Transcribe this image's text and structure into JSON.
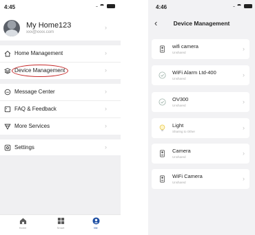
{
  "left_screen": {
    "status": {
      "time": "4:45",
      "signal": "....."
    },
    "profile": {
      "name": "My Home123",
      "email": "xxx@xxxx.com"
    },
    "menu_group_1": [
      {
        "label": "Home Management",
        "icon": "home-icon"
      },
      {
        "label": "Device Management",
        "icon": "layers-icon",
        "highlighted": true
      }
    ],
    "menu_group_2": [
      {
        "label": "Message Center",
        "icon": "message-icon"
      },
      {
        "label": "FAQ & Feedback",
        "icon": "faq-icon"
      },
      {
        "label": "More Services",
        "icon": "services-icon"
      }
    ],
    "menu_group_3": [
      {
        "label": "Settings",
        "icon": "settings-icon"
      }
    ],
    "tabs": [
      {
        "label": "Home",
        "icon": "home-tab-icon",
        "active": false
      },
      {
        "label": "Smart",
        "icon": "smart-tab-icon",
        "active": false
      },
      {
        "label": "Me",
        "icon": "me-tab-icon",
        "active": true
      }
    ],
    "highlight_color": "#c62828",
    "active_tab_color": "#1e4fa3"
  },
  "right_screen": {
    "status": {
      "time": "4:46",
      "signal": "....."
    },
    "title": "Device Management",
    "devices": [
      {
        "name": "wifi camera",
        "status": "Unshared",
        "icon": "camera-device-icon"
      },
      {
        "name": "WiFi Alarm Ltd-400",
        "status": "Unshared",
        "icon": "shield-device-icon"
      },
      {
        "name": "OV300",
        "status": "Unshared",
        "icon": "shield-device-icon"
      },
      {
        "name": "Light",
        "status": "Sharing to Other",
        "icon": "bulb-device-icon"
      },
      {
        "name": "Camera",
        "status": "Unshared",
        "icon": "camera-device-icon"
      },
      {
        "name": "WiFi Camera",
        "status": "Unshared",
        "icon": "camera-device-icon"
      }
    ]
  }
}
